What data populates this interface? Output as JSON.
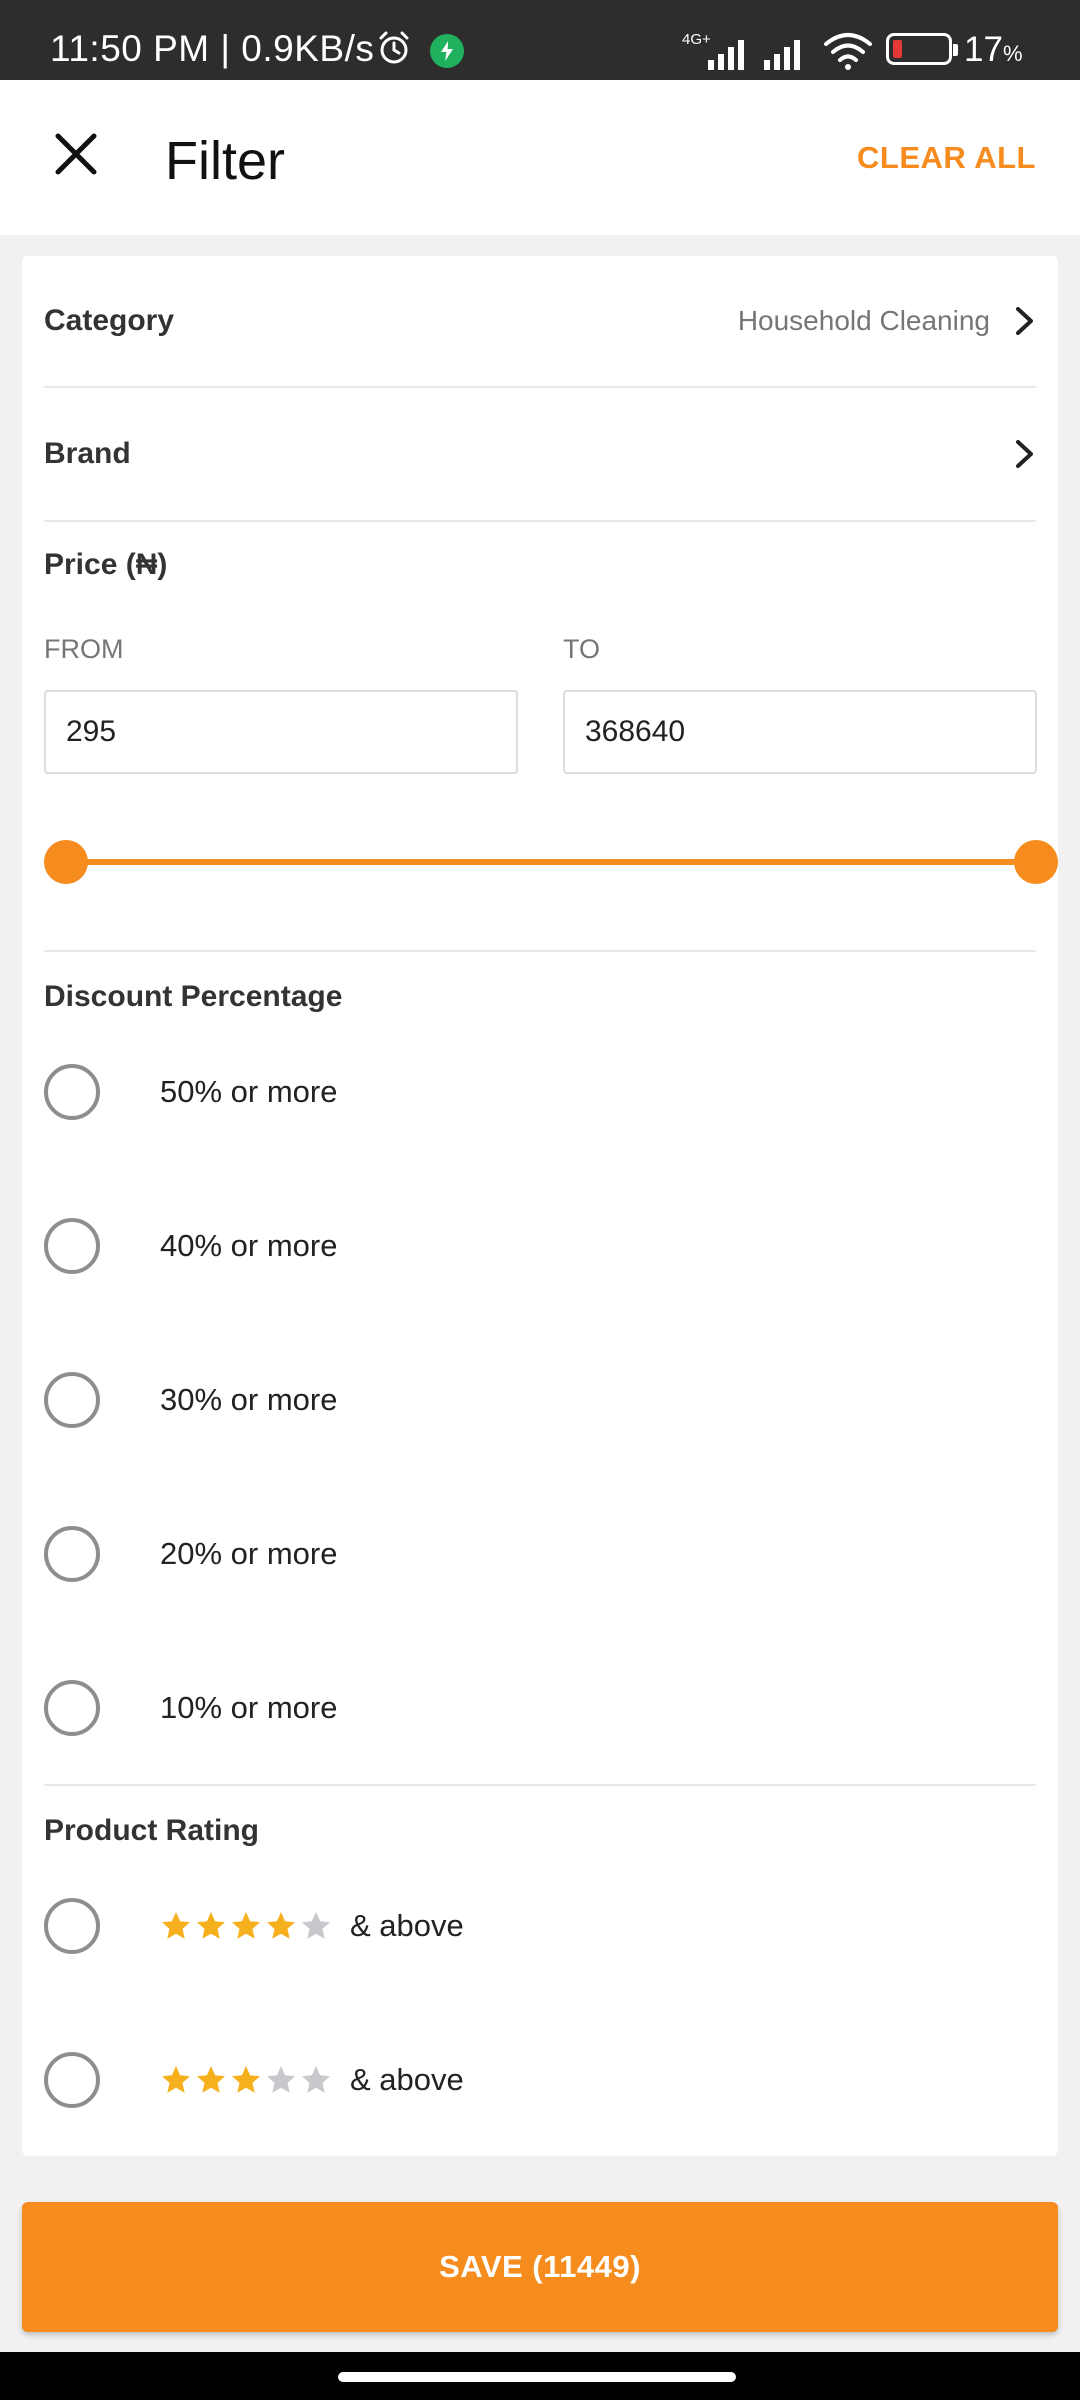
{
  "status_bar": {
    "time_speed": "11:50 PM | 0.9KB/s",
    "network": "4G+",
    "battery_percent": "17",
    "battery_unit": "%"
  },
  "header": {
    "title": "Filter",
    "clear_all": "CLEAR ALL"
  },
  "category": {
    "label": "Category",
    "value": "Household Cleaning"
  },
  "brand": {
    "label": "Brand"
  },
  "price": {
    "label": "Price (₦)",
    "from_label": "FROM",
    "to_label": "TO",
    "from_value": "295",
    "to_value": "368640",
    "slider_min_fraction": 0,
    "slider_max_fraction": 1
  },
  "discount": {
    "label": "Discount Percentage",
    "options": [
      "50% or more",
      "40% or more",
      "30% or more",
      "20% or more",
      "10% or more"
    ]
  },
  "rating": {
    "label": "Product Rating",
    "options": [
      {
        "stars": 4,
        "suffix": "& above"
      },
      {
        "stars": 3,
        "suffix": "& above"
      }
    ]
  },
  "save_button": "SAVE (11449)",
  "colors": {
    "accent": "#f68b1e",
    "star_filled": "#f6b01e",
    "star_empty": "#c8c8cc"
  }
}
